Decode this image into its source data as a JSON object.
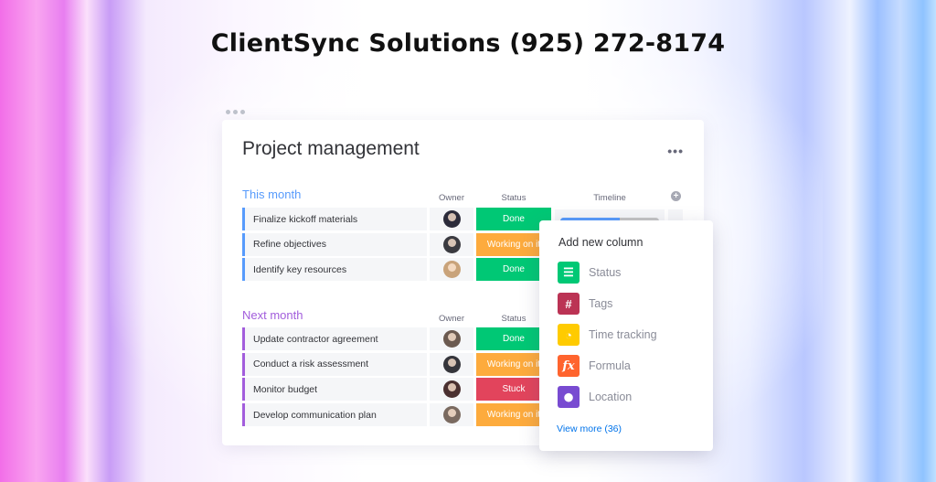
{
  "headline": "ClientSync Solutions (925) 272-8174",
  "board": {
    "title": "Project management",
    "more_icon": "three-dots-icon",
    "add_column_icon": "plus-circle-icon"
  },
  "groups": [
    {
      "title": "This month",
      "color": "#579bfc",
      "columns": {
        "owner": "Owner",
        "status": "Status",
        "timeline": "Timeline"
      },
      "rows": [
        {
          "task": "Finalize kickoff materials",
          "status": "Done",
          "status_color": "#00c875",
          "avatar_color": "#2b2b3a"
        },
        {
          "task": "Refine objectives",
          "status": "Working on it",
          "status_color": "#fdab3d",
          "avatar_color": "#3a3a40"
        },
        {
          "task": "Identify key resources",
          "status": "Done",
          "status_color": "#00c875",
          "avatar_color": "#c9a37a"
        }
      ],
      "timeline_progress": 0.6
    },
    {
      "title": "Next month",
      "color": "#a25ddc",
      "columns": {
        "owner": "Owner",
        "status": "Status"
      },
      "rows": [
        {
          "task": "Update contractor agreement",
          "status": "Done",
          "status_color": "#00c875",
          "avatar_color": "#6b5a50"
        },
        {
          "task": "Conduct a risk assessment",
          "status": "Working on it",
          "status_color": "#fdab3d",
          "avatar_color": "#35353b"
        },
        {
          "task": "Monitor budget",
          "status": "Stuck",
          "status_color": "#e2445c",
          "avatar_color": "#4a3030"
        },
        {
          "task": "Develop communication plan",
          "status": "Working on it",
          "status_color": "#fdab3d",
          "avatar_color": "#7a6a60"
        }
      ]
    }
  ],
  "popup": {
    "title": "Add new column",
    "options": [
      {
        "label": "Status",
        "icon": "status-icon",
        "glyph": "☰",
        "color": "#00c875"
      },
      {
        "label": "Tags",
        "icon": "hashtag-icon",
        "glyph": "#",
        "color": "#bb3354"
      },
      {
        "label": "Time tracking",
        "icon": "clock-icon",
        "glyph": "◔",
        "color": "#ffcb00"
      },
      {
        "label": "Formula",
        "icon": "formula-icon",
        "glyph": "fx",
        "color": "#ff642e"
      },
      {
        "label": "Location",
        "icon": "location-pin-icon",
        "glyph": "⬤",
        "color": "#784bd1"
      }
    ],
    "view_more": "View more (36)"
  }
}
